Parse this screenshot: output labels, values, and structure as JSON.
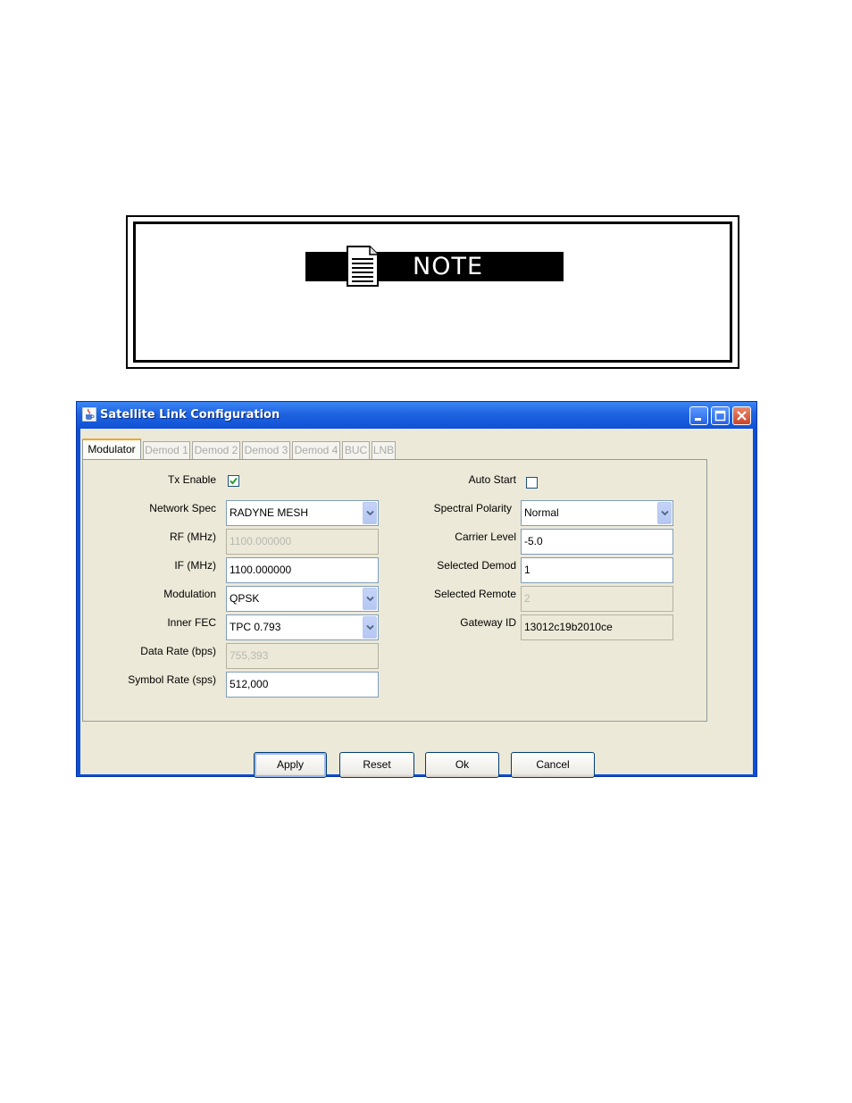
{
  "note": {
    "title": "NOTE",
    "icon": "document-icon"
  },
  "window": {
    "title": "Satellite Link Configuration",
    "app_icon": "java-cup-icon",
    "controls": [
      "minimize-icon",
      "maximize-icon",
      "close-icon"
    ]
  },
  "tabs": [
    {
      "label": "Modulator",
      "active": true
    },
    {
      "label": "Demod 1",
      "active": false
    },
    {
      "label": "Demod 2",
      "active": false
    },
    {
      "label": "Demod 3",
      "active": false
    },
    {
      "label": "Demod 4",
      "active": false
    },
    {
      "label": "BUC",
      "active": false
    },
    {
      "label": "LNB",
      "active": false
    }
  ],
  "left": {
    "tx_enable": {
      "label": "Tx Enable",
      "checked": true
    },
    "network_spec": {
      "label": "Network Spec",
      "value": "RADYNE MESH"
    },
    "rf": {
      "label": "RF (MHz)",
      "value": "1100.000000",
      "disabled": true
    },
    "if": {
      "label": "IF (MHz)",
      "value": "1100.000000"
    },
    "modulation": {
      "label": "Modulation",
      "value": "QPSK"
    },
    "inner_fec": {
      "label": "Inner FEC",
      "value": "TPC 0.793"
    },
    "data_rate": {
      "label": "Data Rate (bps)",
      "value": "755,393",
      "disabled": true
    },
    "symbol_rate": {
      "label": "Symbol Rate (sps)",
      "value": "512,000"
    }
  },
  "right": {
    "auto_start": {
      "label": "Auto Start",
      "checked": false
    },
    "spectral_polarity": {
      "label": "Spectral Polarity",
      "value": "Normal"
    },
    "carrier_level": {
      "label": "Carrier Level",
      "value": "-5.0"
    },
    "selected_demod": {
      "label": "Selected Demod",
      "value": "1"
    },
    "selected_remote": {
      "label": "Selected Remote",
      "value": "2",
      "disabled": true
    },
    "gateway_id": {
      "label": "Gateway ID",
      "value": "13012c19b2010ce"
    }
  },
  "buttons": {
    "apply": "Apply",
    "reset": "Reset",
    "ok": "Ok",
    "cancel": "Cancel"
  },
  "colors": {
    "title_bar": "#1f63e0",
    "client_bg": "#ece9d8",
    "active_tab_accent": "#f1a62c",
    "check_mark": "#21a121"
  }
}
